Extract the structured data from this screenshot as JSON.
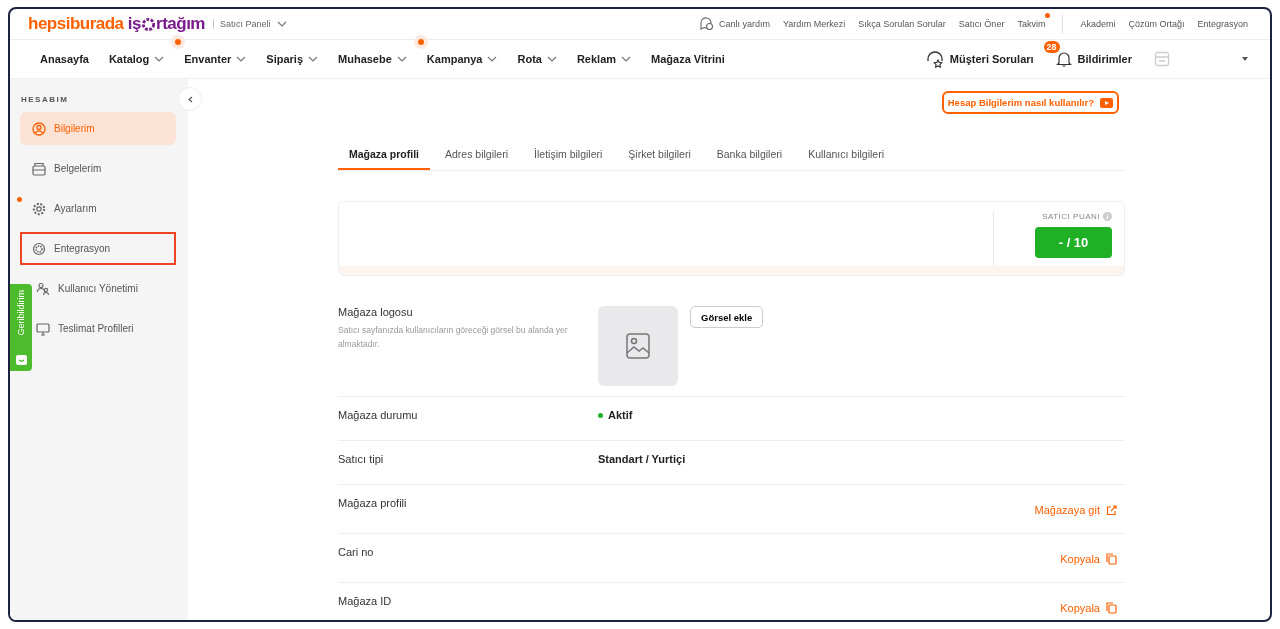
{
  "brand": {
    "name": "hepsiburada",
    "product_prefix": "iş",
    "product_suffix": "rtağım",
    "context": "Satıcı Paneli"
  },
  "top_links": [
    {
      "label": "Canlı yardım",
      "kind": "chat",
      "dot": false
    },
    {
      "label": "Yardım Merkezi",
      "kind": "plain",
      "dot": false
    },
    {
      "label": "Sıkça Sorulan Sorular",
      "kind": "plain",
      "dot": false
    },
    {
      "label": "Satıcı Öner",
      "kind": "plain",
      "dot": false
    },
    {
      "label": "Takvim",
      "kind": "plain",
      "dot": true
    }
  ],
  "top_links_secondary": [
    "Akademi",
    "Çözüm Ortağı",
    "Entegrasyon"
  ],
  "nav": [
    {
      "label": "Anasayfa",
      "dropdown": false,
      "dot": false
    },
    {
      "label": "Katalog",
      "dropdown": true,
      "dot": false
    },
    {
      "label": "Envanter",
      "dropdown": true,
      "dot": true
    },
    {
      "label": "Sipariş",
      "dropdown": true,
      "dot": false
    },
    {
      "label": "Muhasebe",
      "dropdown": true,
      "dot": false
    },
    {
      "label": "Kampanya",
      "dropdown": true,
      "dot": true
    },
    {
      "label": "Rota",
      "dropdown": true,
      "dot": false
    },
    {
      "label": "Reklam",
      "dropdown": true,
      "dot": false
    },
    {
      "label": "Mağaza Vitrini",
      "dropdown": false,
      "dot": false
    }
  ],
  "nav_right": {
    "questions": "Müşteri Soruları",
    "notification_count": "28",
    "notifications": "Bildirimler"
  },
  "sidebar": {
    "heading": "HESABIM",
    "items": [
      {
        "label": "Bilgilerim",
        "selected": true,
        "dot": false,
        "highlighted": false
      },
      {
        "label": "Belgelerim",
        "selected": false,
        "dot": false,
        "highlighted": false
      },
      {
        "label": "Ayarlarım",
        "selected": false,
        "dot": true,
        "highlighted": false
      },
      {
        "label": "Entegrasyon",
        "selected": false,
        "dot": false,
        "highlighted": true
      },
      {
        "label": "Kullanıcı Yönetimi",
        "selected": false,
        "dot": false,
        "highlighted": false
      },
      {
        "label": "Teslimat Profilleri",
        "selected": false,
        "dot": false,
        "highlighted": false
      }
    ]
  },
  "feedback_tab": "Geribildirim",
  "help_button": "Hesap Bilgilerim nasıl kullanılır?",
  "tabs": [
    {
      "label": "Mağaza profili",
      "selected": true
    },
    {
      "label": "Adres bilgileri",
      "selected": false
    },
    {
      "label": "İletişim bilgileri",
      "selected": false
    },
    {
      "label": "Şirket bilgileri",
      "selected": false
    },
    {
      "label": "Banka bilgileri",
      "selected": false
    },
    {
      "label": "Kullanıcı bilgileri",
      "selected": false
    }
  ],
  "score": {
    "label": "SATICI PUANI",
    "value": "- / 10"
  },
  "logo_section": {
    "label": "Mağaza logosu",
    "description": "Satıcı sayfanızda kullanıcıların göreceği görsel bu alanda yer almaktadır.",
    "button": "Görsel ekle"
  },
  "rows": [
    {
      "label": "Mağaza durumu",
      "kind": "status",
      "value": "Aktif"
    },
    {
      "label": "Satıcı tipi",
      "kind": "text",
      "value": "Standart / Yurtiçi"
    },
    {
      "label": "Mağaza profili",
      "kind": "external",
      "value": "Mağazaya git"
    },
    {
      "label": "Cari no",
      "kind": "copy",
      "value": "Kopyala"
    },
    {
      "label": "Mağaza ID",
      "kind": "copy",
      "value": "Kopyala"
    }
  ]
}
